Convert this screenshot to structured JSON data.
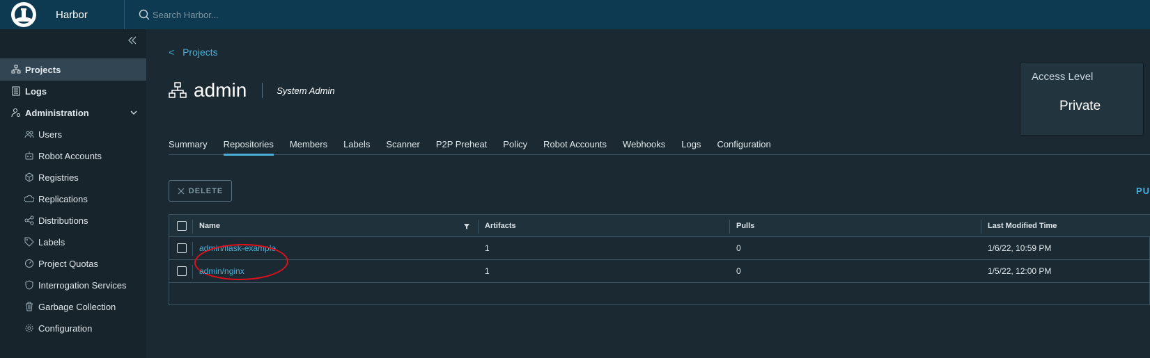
{
  "header": {
    "app_name": "Harbor",
    "search_placeholder": "Search Harbor..."
  },
  "sidebar": {
    "items": [
      {
        "label": "Projects",
        "icon": "projects-icon"
      },
      {
        "label": "Logs",
        "icon": "logs-icon"
      },
      {
        "label": "Administration",
        "icon": "administration-icon"
      },
      {
        "label": "Users",
        "icon": "users-icon"
      },
      {
        "label": "Robot Accounts",
        "icon": "robot-icon"
      },
      {
        "label": "Registries",
        "icon": "registries-icon"
      },
      {
        "label": "Replications",
        "icon": "replications-icon"
      },
      {
        "label": "Distributions",
        "icon": "distributions-icon"
      },
      {
        "label": "Labels",
        "icon": "tag-icon"
      },
      {
        "label": "Project Quotas",
        "icon": "quota-icon"
      },
      {
        "label": "Interrogation Services",
        "icon": "shield-icon"
      },
      {
        "label": "Garbage Collection",
        "icon": "trash-icon"
      },
      {
        "label": "Configuration",
        "icon": "gear-icon"
      }
    ]
  },
  "breadcrumb": {
    "back": "<",
    "label": "Projects"
  },
  "project": {
    "name": "admin",
    "role": "System Admin"
  },
  "access": {
    "label": "Access Level",
    "value": "Private"
  },
  "tabs": [
    "Summary",
    "Repositories",
    "Members",
    "Labels",
    "Scanner",
    "P2P Preheat",
    "Policy",
    "Robot Accounts",
    "Webhooks",
    "Logs",
    "Configuration"
  ],
  "active_tab": "Repositories",
  "toolbar": {
    "delete_label": "DELETE",
    "push_label": "PU"
  },
  "table": {
    "columns": [
      "Name",
      "Artifacts",
      "Pulls",
      "Last Modified Time"
    ],
    "rows": [
      {
        "name": "admin/flask-example",
        "artifacts": "1",
        "pulls": "0",
        "modified": "1/6/22, 10:59 PM"
      },
      {
        "name": "admin/nginx",
        "artifacts": "1",
        "pulls": "0",
        "modified": "1/5/22, 12:00 PM"
      }
    ]
  },
  "colors": {
    "header_bg": "#0e3a51",
    "accent": "#49afd9",
    "annotation": "#e0101a"
  }
}
